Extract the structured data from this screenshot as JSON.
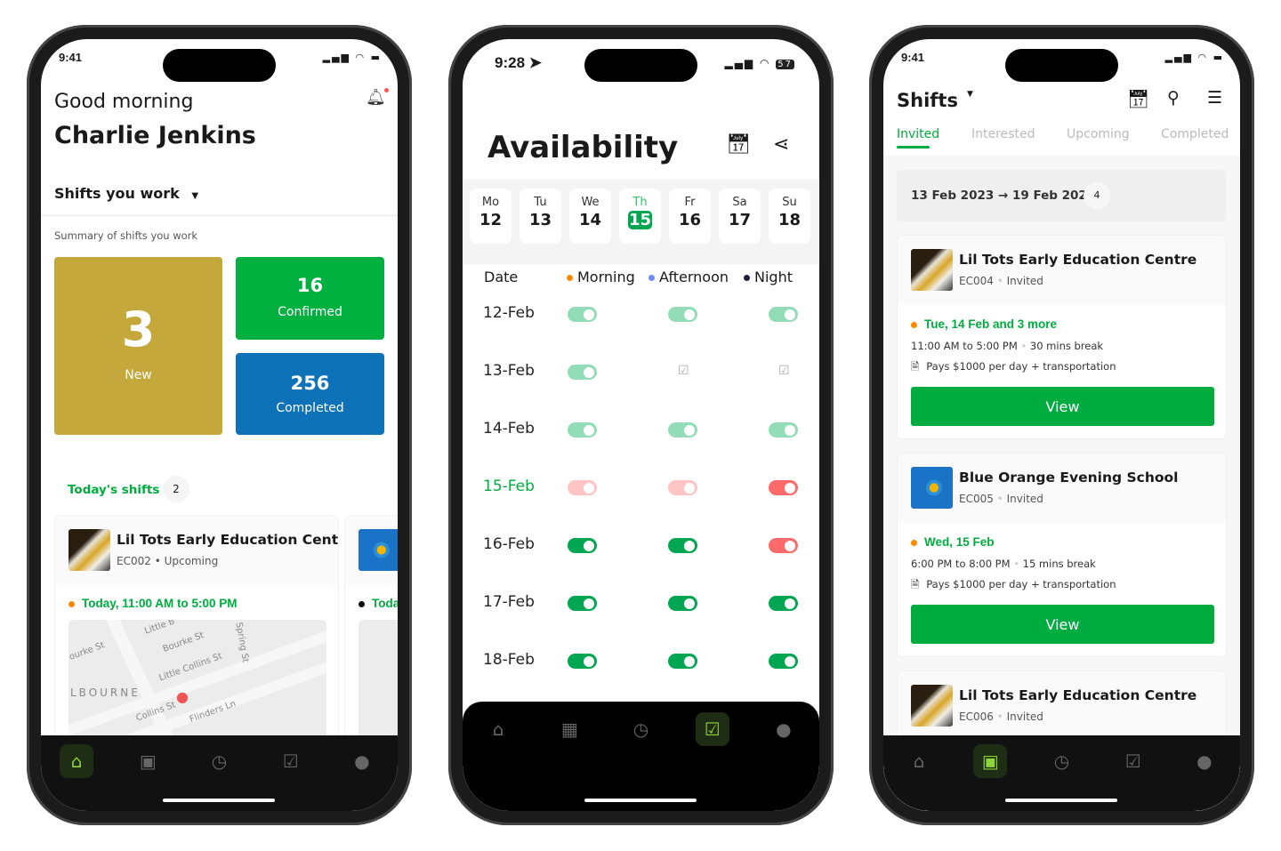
{
  "colors": {
    "brand_green": "#00ac3f",
    "gold": "#c4a83c",
    "blue": "#0e72b9",
    "toggle_on": "#00a651",
    "toggle_pending": "#93dcb8",
    "toggle_off_light": "#ffc4c4",
    "toggle_off": "#ff6b6b"
  },
  "home": {
    "status_time": "9:41",
    "greeting": "Good morning",
    "user_name": "Charlie Jenkins",
    "dropdown_label": "Shifts you work",
    "summary_label": "Summary of shifts you work",
    "stats": {
      "new_count": "3",
      "new_label": "New",
      "confirmed_count": "16",
      "confirmed_label": "Confirmed",
      "completed_count": "256",
      "completed_label": "Completed"
    },
    "todays_shifts_label": "Today's shifts",
    "todays_shifts_count": "2",
    "shift_card": {
      "name": "Lil Tots Early Education Cent..",
      "code": "EC002",
      "status": "Upcoming",
      "time": "Today, 11:00 AM to 5:00 PM"
    },
    "second_card_time": "Toda",
    "map_labels": [
      "Little B",
      "ourke St",
      "Bourke St",
      "Spring St",
      "Little Collins St",
      "LBOURNE",
      "Collins St",
      "Flinders Ln"
    ],
    "nav": [
      "home-icon",
      "calendar-icon",
      "stopwatch-icon",
      "calendar-check-icon",
      "account-icon"
    ],
    "nav_active": 0
  },
  "availability": {
    "status_time": "9:28",
    "battery": "57",
    "title": "Availability",
    "days": [
      {
        "d": "Mo",
        "n": "12"
      },
      {
        "d": "Tu",
        "n": "13"
      },
      {
        "d": "We",
        "n": "14"
      },
      {
        "d": "Th",
        "n": "15",
        "selected": true
      },
      {
        "d": "Fr",
        "n": "16"
      },
      {
        "d": "Sa",
        "n": "17"
      },
      {
        "d": "Su",
        "n": "18"
      }
    ],
    "header": {
      "date": "Date",
      "morning": "Morning",
      "afternoon": "Afternoon",
      "night": "Night"
    },
    "legend_colors": {
      "morning": "#ff8a00",
      "afternoon": "#6e8ef0",
      "night": "#1a2240"
    },
    "rows": [
      {
        "date": "12-Feb",
        "slots": [
          "pending",
          "pending",
          "pending"
        ]
      },
      {
        "date": "13-Feb",
        "slots": [
          "pending",
          "calendar",
          "calendar"
        ]
      },
      {
        "date": "14-Feb",
        "slots": [
          "pending",
          "pending",
          "pending"
        ]
      },
      {
        "date": "15-Feb",
        "today": true,
        "slots": [
          "off_light",
          "off_light",
          "off"
        ]
      },
      {
        "date": "16-Feb",
        "slots": [
          "on",
          "on",
          "off"
        ]
      },
      {
        "date": "17-Feb",
        "slots": [
          "on",
          "on",
          "on"
        ]
      },
      {
        "date": "18-Feb",
        "slots": [
          "on",
          "on",
          "on"
        ]
      }
    ],
    "nav": [
      "home-icon",
      "calendar-grid-icon",
      "stopwatch-icon",
      "calendar-check-icon",
      "account-icon"
    ],
    "nav_active": 3
  },
  "shifts": {
    "status_time": "9:41",
    "title": "Shifts",
    "tabs": [
      "Invited",
      "Interested",
      "Upcoming",
      "Completed"
    ],
    "active_tab": 0,
    "date_range": "13 Feb 2023 → 19 Feb 2023",
    "range_count": "4",
    "cards": [
      {
        "name": "Lil Tots Early Education Centre",
        "code": "EC004",
        "status": "Invited",
        "date": "Tue, 14 Feb and 3 more",
        "time": "11:00 AM to 5:00 PM",
        "break": "30 mins break",
        "pay": "Pays $1000 per day + transportation",
        "button": "View",
        "logo": "eagle"
      },
      {
        "name": "Blue Orange Evening School",
        "code": "EC005",
        "status": "Invited",
        "date": "Wed, 15 Feb",
        "time": "6:00 PM to 8:00 PM",
        "break": "15 mins break",
        "pay": "Pays $1000 per day + transportation",
        "button": "View",
        "logo": "blue"
      },
      {
        "name": "Lil Tots Early Education Centre",
        "code": "EC006",
        "status": "Invited",
        "logo": "eagle"
      }
    ],
    "nav": [
      "home-icon",
      "calendar-icon",
      "stopwatch-icon",
      "calendar-check-icon",
      "account-icon"
    ],
    "nav_active": 1
  }
}
